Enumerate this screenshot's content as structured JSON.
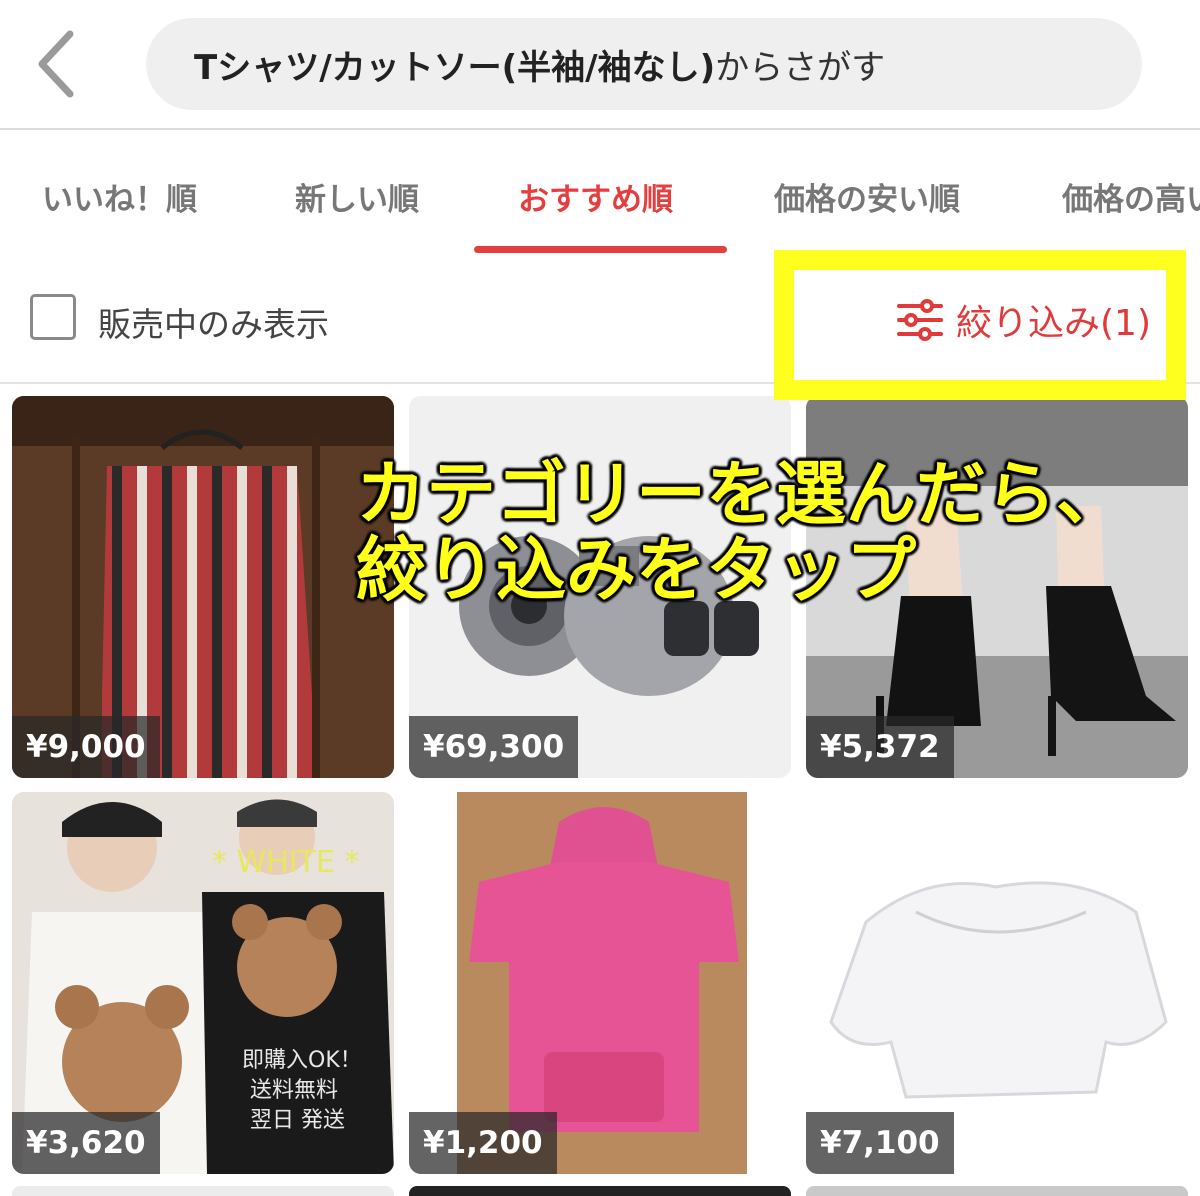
{
  "header": {
    "search_query": "Tシャツ/カットソー(半袖/袖なし)",
    "search_suffix": "からさがす"
  },
  "sort_tabs": [
    {
      "label": "いいね！順",
      "active": false
    },
    {
      "label": "新しい順",
      "active": false
    },
    {
      "label": "おすすめ順",
      "active": true
    },
    {
      "label": "価格の安い順",
      "active": false
    },
    {
      "label": "価格の高い順",
      "active": false
    }
  ],
  "filters": {
    "on_sale_only_label": "販売中のみ表示",
    "on_sale_only_checked": false,
    "refine_label": "絞り込み(1)"
  },
  "annotation": {
    "line1": "カテゴリーを選んだら、",
    "line2": "絞り込みをタップ"
  },
  "products": [
    {
      "price": "¥9,000",
      "image": "striped-sleeveless-top"
    },
    {
      "price": "¥69,300",
      "image": "turbocharger"
    },
    {
      "price": "¥5,372",
      "image": "black-heeled-boots"
    },
    {
      "price": "¥3,620",
      "image": "bear-print-tshirts",
      "overlay_text": [
        "* WHITE *",
        "即購入OK！",
        "送料無料",
        "翌日 発送"
      ]
    },
    {
      "price": "¥1,200",
      "image": "pink-hooded-top"
    },
    {
      "price": "¥7,100",
      "image": "white-puff-sleeve-blouse"
    }
  ],
  "colors": {
    "accent": "#e53e3e",
    "highlight": "#ffff1f"
  }
}
